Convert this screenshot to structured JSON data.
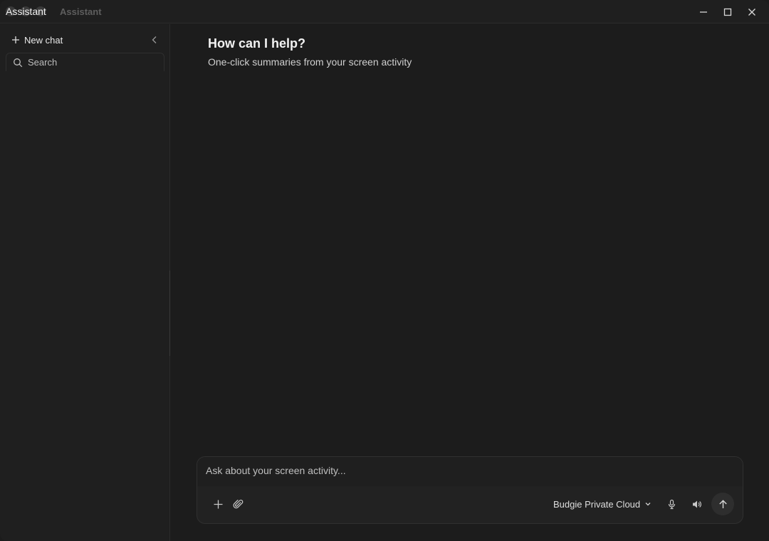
{
  "titlebar": {
    "title": "Assistant",
    "dim_title": "Assistant",
    "controls": [
      "minimize-icon",
      "maximize-icon",
      "close-icon"
    ]
  },
  "sidebar": {
    "new_chat_label": "New chat",
    "search_placeholder": "Search",
    "search_value": ""
  },
  "main": {
    "heading": "How can I help?",
    "subheading": "One-click summaries from your screen activity"
  },
  "composer": {
    "placeholder": "Ask about your screen activity...",
    "value": "",
    "model_selected": "Budgie Private Cloud"
  },
  "colors": {
    "background": "#1c1c1c",
    "sidebar": "#1f1f1f",
    "composer": "#222222",
    "text": "#e6e6e6"
  }
}
